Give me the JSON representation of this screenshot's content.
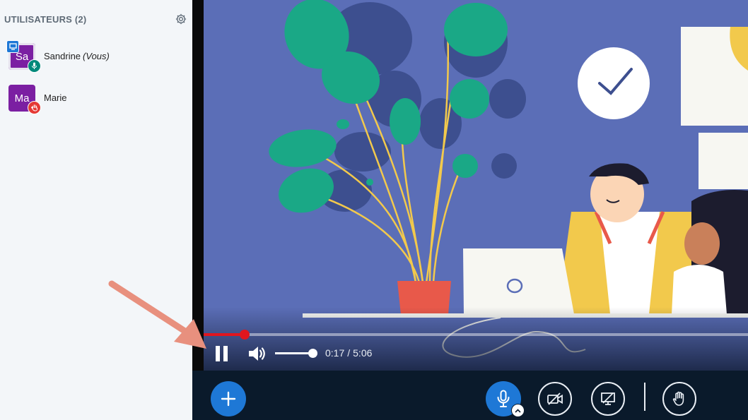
{
  "sidebar": {
    "title": "UTILISATEURS (2)",
    "users": [
      {
        "initials": "Sa",
        "name": "Sandrine",
        "you_label": "(Vous)",
        "role": "presenter",
        "status": "mic-icon"
      },
      {
        "initials": "Ma",
        "name": "Marie",
        "you_label": "",
        "role": "viewer",
        "status": "raised-hand-icon"
      }
    ]
  },
  "player": {
    "current_time": "0:17",
    "separator": "/",
    "duration": "5:06",
    "progress_percent": 7.5,
    "volume_percent": 100
  },
  "colors": {
    "video_background": "#5b6eb7",
    "progress": "#e0161e",
    "accent_blue": "#1e78d6",
    "avatar_purple": "#7b1fa2",
    "annotation_arrow": "#e8907e"
  }
}
